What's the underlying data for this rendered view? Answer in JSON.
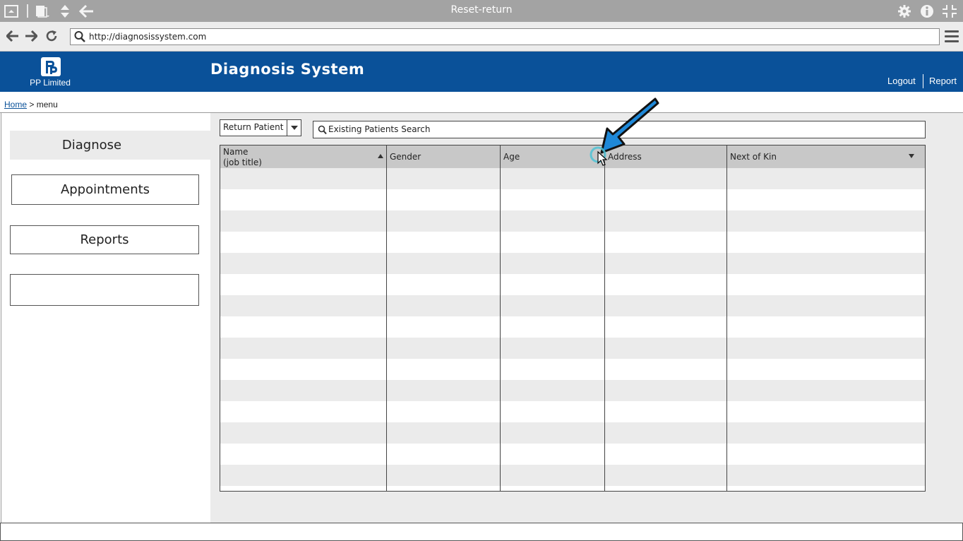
{
  "window": {
    "title": "Reset-return"
  },
  "browser": {
    "url": "http://diagnosissystem.com"
  },
  "header": {
    "logo_text": "P",
    "company": "PP Limited",
    "title": "Diagnosis System",
    "links": [
      "Logout",
      "Report"
    ],
    "background_color": "#0a5199"
  },
  "breadcrumb": {
    "home": "Home",
    "separator": ">",
    "current": "menu"
  },
  "sidebar": {
    "active": "Diagnose",
    "items": [
      "Appointments",
      "Reports",
      ""
    ]
  },
  "toolbar": {
    "select_value": "Return Patient",
    "search_placeholder": "Existing Patients Search"
  },
  "table": {
    "columns": [
      "Name",
      "Gender",
      "Age",
      "Address",
      "Next of Kin"
    ],
    "name_subtitle": "(job title)",
    "row_count": 15,
    "rows": []
  },
  "icons": {
    "search": "search-icon",
    "settings": "gear-icon",
    "info": "info-icon",
    "fullscreen": "collapse-icon",
    "annotation": "blue-arrow-icon"
  }
}
